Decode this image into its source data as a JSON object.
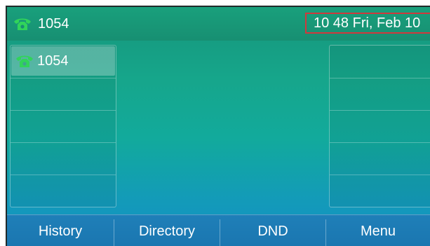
{
  "status_bar": {
    "account": "1054",
    "clock_text": "10 48 Fri, Feb 10"
  },
  "line_keys": {
    "left": [
      {
        "label": "1054",
        "icon": "phone-icon",
        "selected": true
      },
      {
        "label": ""
      },
      {
        "label": ""
      },
      {
        "label": ""
      },
      {
        "label": ""
      }
    ],
    "right": [
      {
        "label": ""
      },
      {
        "label": ""
      },
      {
        "label": ""
      },
      {
        "label": ""
      },
      {
        "label": ""
      }
    ]
  },
  "softkeys": [
    "History",
    "Directory",
    "DND",
    "Menu"
  ],
  "colors": {
    "icon_green": "#31d45a",
    "highlight_border": "#d1383c",
    "softkey_bar": "#1a76b0"
  }
}
